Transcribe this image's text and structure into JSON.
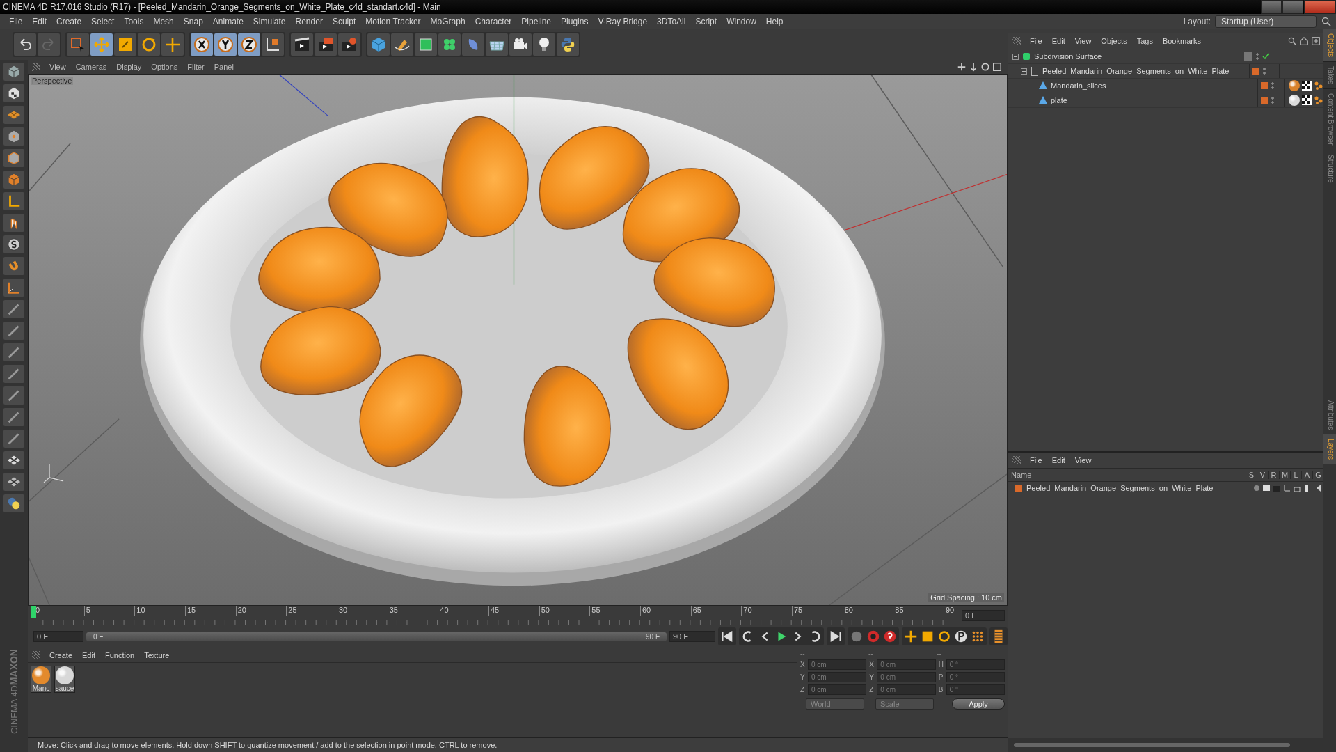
{
  "window": {
    "title": "CINEMA 4D R17.016 Studio (R17) - [Peeled_Mandarin_Orange_Segments_on_White_Plate_c4d_standart.c4d] - Main"
  },
  "menu": [
    "File",
    "Edit",
    "Create",
    "Select",
    "Tools",
    "Mesh",
    "Snap",
    "Animate",
    "Simulate",
    "Render",
    "Sculpt",
    "Motion Tracker",
    "MoGraph",
    "Character",
    "Pipeline",
    "Plugins",
    "V-Ray Bridge",
    "3DToAll",
    "Script",
    "Window",
    "Help"
  ],
  "layout": {
    "label": "Layout:",
    "value": "Startup (User)"
  },
  "viewport": {
    "menu": [
      "View",
      "Cameras",
      "Display",
      "Options",
      "Filter",
      "Panel"
    ],
    "camera": "Perspective",
    "grid_spacing": "Grid Spacing : 10 cm"
  },
  "timeline": {
    "ticks": [
      "0",
      "5",
      "10",
      "15",
      "20",
      "25",
      "30",
      "35",
      "40",
      "45",
      "50",
      "55",
      "60",
      "65",
      "70",
      "75",
      "80",
      "85",
      "90"
    ],
    "current": "0 F",
    "start": "0 F",
    "range": {
      "start": "0 F",
      "end": "90 F",
      "level": 1
    },
    "end": "90 F"
  },
  "materials": {
    "menu": [
      "Create",
      "Edit",
      "Function",
      "Texture"
    ],
    "items": [
      {
        "name": "Manc",
        "color": "#e38a2c"
      },
      {
        "name": "sauce",
        "color": "#d8d8d8"
      }
    ]
  },
  "coordinates": {
    "headers": [
      "--",
      "--",
      "--"
    ],
    "rows": [
      [
        {
          "axis": "X",
          "value": "0 cm"
        },
        {
          "axis": "X",
          "value": "0 cm"
        },
        {
          "axis": "H",
          "value": "0 °"
        }
      ],
      [
        {
          "axis": "Y",
          "value": "0 cm"
        },
        {
          "axis": "Y",
          "value": "0 cm"
        },
        {
          "axis": "P",
          "value": "0 °"
        }
      ],
      [
        {
          "axis": "Z",
          "value": "0 cm"
        },
        {
          "axis": "Z",
          "value": "0 cm"
        },
        {
          "axis": "B",
          "value": "0 °"
        }
      ]
    ],
    "dropdowns": [
      "World",
      "Scale"
    ],
    "apply": "Apply"
  },
  "status_bar": "Move: Click and drag to move elements. Hold down SHIFT to quantize movement / add to the selection in point mode, CTRL to remove.",
  "logo": {
    "line1": "MAXON",
    "line2": "CINEMA 4D"
  },
  "objects": {
    "menu": [
      "File",
      "Edit",
      "View",
      "Objects",
      "Tags",
      "Bookmarks"
    ],
    "tree": [
      {
        "name": "Subdivision Surface",
        "kind": "generator",
        "children": [
          {
            "name": "Peeled_Mandarin_Orange_Segments_on_White_Plate",
            "kind": "null",
            "children": [
              {
                "name": "Mandarin_slices",
                "kind": "polygon",
                "color": "#d9822b"
              },
              {
                "name": "plate",
                "kind": "polygon",
                "color": "#dcdcdc"
              }
            ]
          }
        ]
      }
    ]
  },
  "layers": {
    "menu": [
      "File",
      "Edit",
      "View"
    ],
    "columns": [
      "Name",
      "S",
      "V",
      "R",
      "M",
      "L",
      "A",
      "G"
    ],
    "rows": [
      {
        "name": "Peeled_Mandarin_Orange_Segments_on_White_Plate",
        "color": "#d9692a"
      }
    ]
  },
  "side_tabs_top": [
    {
      "label": "Objects",
      "selected": true
    },
    {
      "label": "Takes",
      "selected": false
    },
    {
      "label": "Content Browser",
      "selected": false
    },
    {
      "label": "Structure",
      "selected": false
    }
  ],
  "side_tabs_bottom": [
    {
      "label": "Attributes",
      "selected": false
    },
    {
      "label": "Layers",
      "selected": true
    }
  ]
}
